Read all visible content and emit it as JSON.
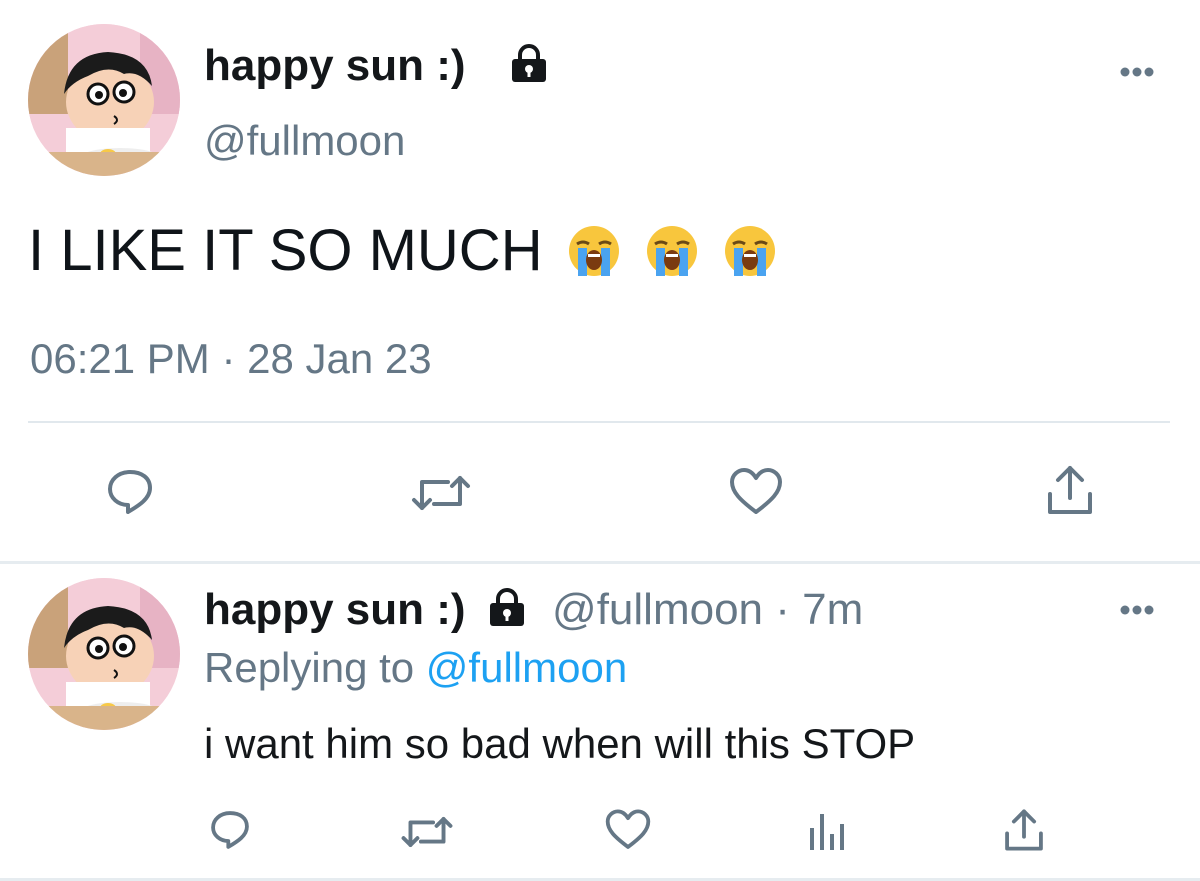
{
  "tweet": {
    "display_name": "happy sun :)",
    "handle": "@fullmoon",
    "text": "I LIKE IT SO MUCH",
    "emojis": [
      "loudly-crying-face",
      "loudly-crying-face",
      "loudly-crying-face"
    ],
    "timestamp": "06:21 PM",
    "separator": "·",
    "date": "28 Jan 23",
    "actions": [
      "reply-icon",
      "retweet-icon",
      "like-icon",
      "share-icon"
    ]
  },
  "reply": {
    "display_name": "happy sun :)",
    "handle": "@fullmoon",
    "separator": "·",
    "time_ago": "7m",
    "replying_prefix": "Replying to",
    "replying_handle": "@fullmoon",
    "text": "i want him so bad when will this STOP",
    "actions": [
      "reply-icon",
      "retweet-icon",
      "like-icon",
      "analytics-icon",
      "share-icon"
    ]
  },
  "colors": {
    "text": "#14171a",
    "secondary": "#657786",
    "link": "#1da1f2",
    "divider": "#e1e8ed"
  }
}
